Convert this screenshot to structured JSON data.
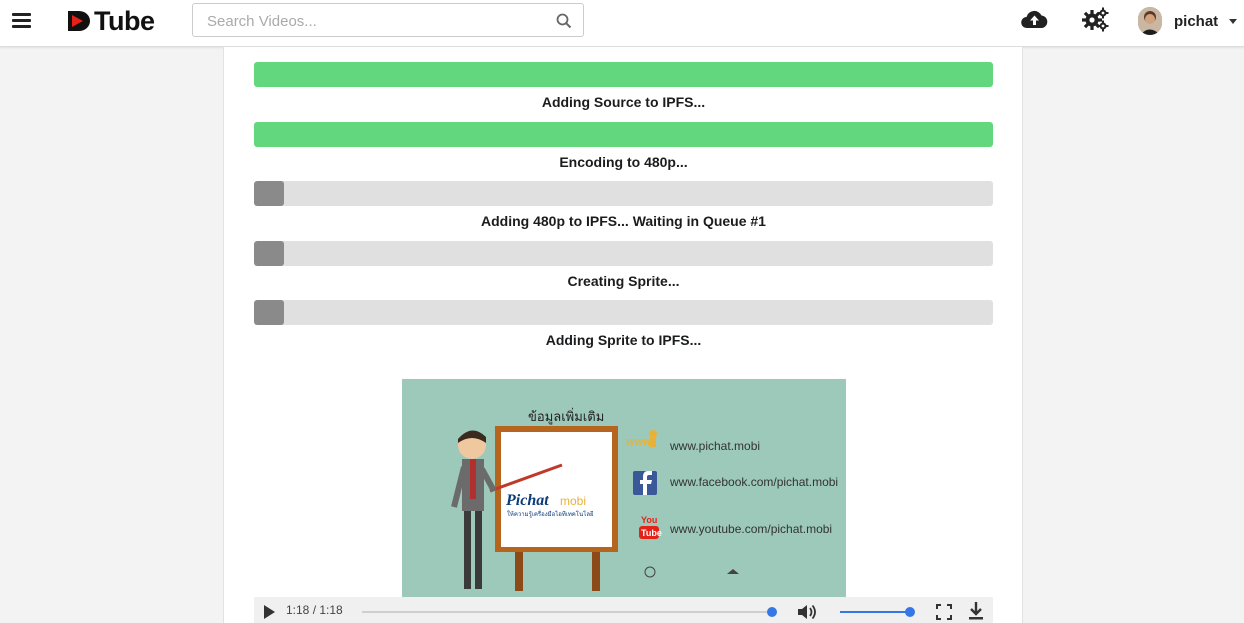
{
  "header": {
    "logo_text": "Tube",
    "search_placeholder": "Search Videos...",
    "user_name": "pichat"
  },
  "steps": [
    {
      "label": "Adding Source to IPFS...",
      "progress": 1.0,
      "state": "done"
    },
    {
      "label": "Encoding to 480p...",
      "progress": 1.0,
      "state": "done"
    },
    {
      "label": "Adding 480p to IPFS... Waiting in Queue #1",
      "progress": 0.04,
      "state": "pending"
    },
    {
      "label": "Creating Sprite...",
      "progress": 0.04,
      "state": "pending"
    },
    {
      "label": "Adding Sprite to IPFS...",
      "progress": 0.04,
      "state": "pending"
    }
  ],
  "video": {
    "slide_title": "ข้อมูลเพิ่มเติม",
    "website": "www.pichat.mobi",
    "facebook": "www.facebook.com/pichat.mobi",
    "youtube": "www.youtube.com/pichat.mobi",
    "brand": "Pichat",
    "brand_suffix": "mobi",
    "brand_tagline": "ให้ความรู้เครื่องมือไอทีเทคโนโลยี",
    "www_icon_text": "www",
    "youtube_icon_top": "You",
    "youtube_icon_bottom": "Tube"
  },
  "player": {
    "time": "1:18 / 1:18",
    "seek_progress": 1.0,
    "volume": 1.0
  },
  "colors": {
    "done": "#63d77e",
    "pending": "#8a8a8a",
    "accent": "#3578e5",
    "brand_red": "#e62117"
  }
}
